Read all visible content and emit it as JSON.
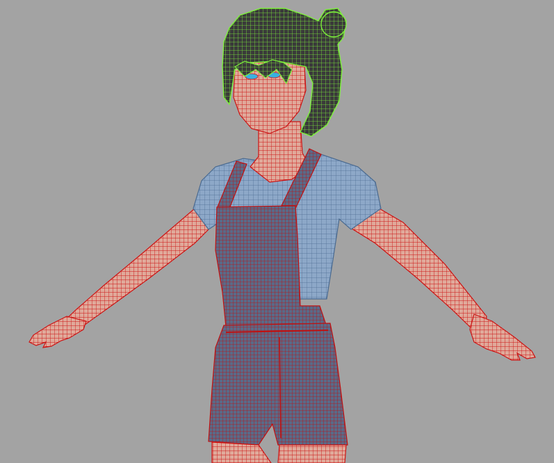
{
  "viewport": {
    "background": "#a3a3a3",
    "subject": "wireframe-character-t-pose"
  },
  "colors": {
    "skin_wire": "#cc1414",
    "skin_fill": "#e0a99a",
    "shirt_fill": "#8da8c8",
    "shirt_wire": "#4a6a90",
    "overalls_fill": "#5a6a88",
    "overalls_wire": "#c01010",
    "hair_fill": "#3a3a3a",
    "hair_wire": "#7cf03a",
    "eye": "#3ab0e0"
  }
}
